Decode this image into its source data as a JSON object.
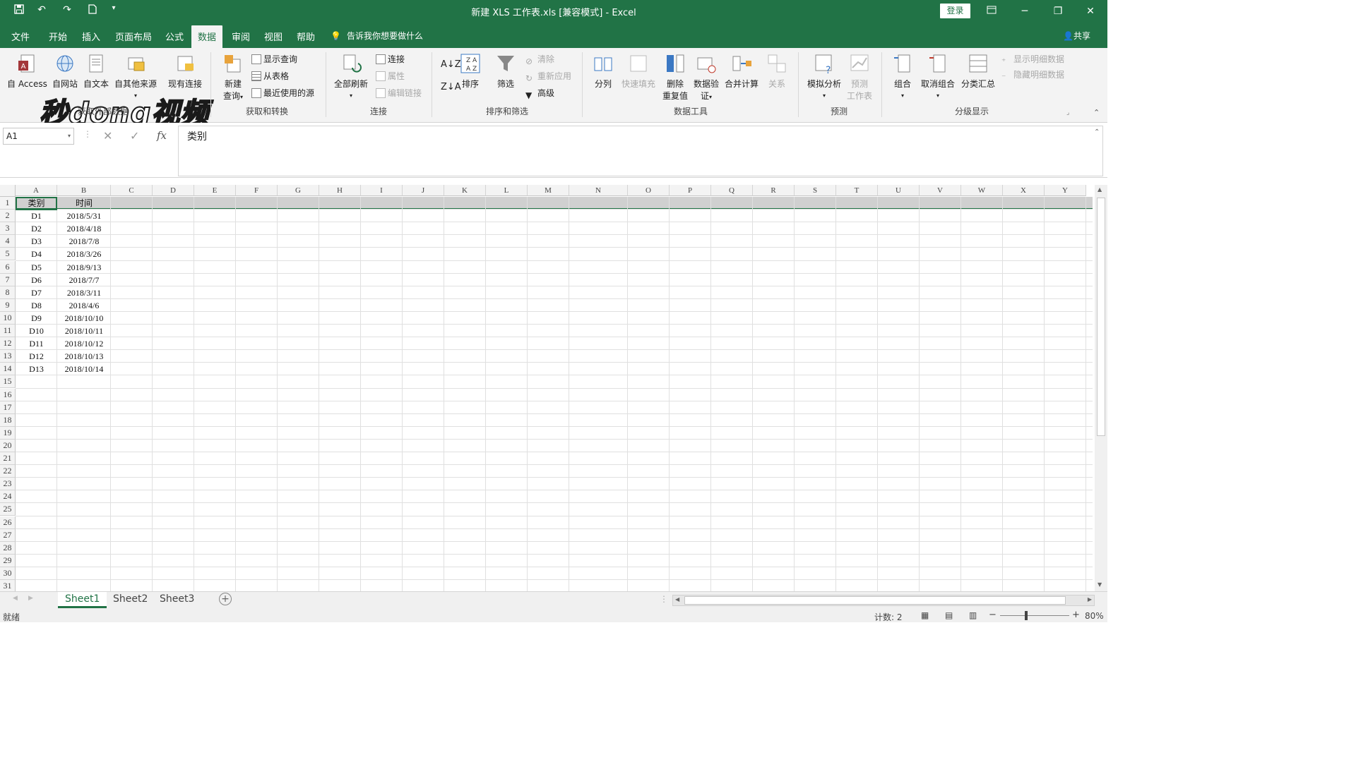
{
  "titlebar": {
    "title": "新建 XLS 工作表.xls  [兼容模式]  -  Excel",
    "login_label": "登录",
    "quick_access": [
      "save-icon",
      "undo-icon",
      "redo-icon",
      "new-file-icon",
      "customize-icon"
    ]
  },
  "ribbon_tabs": [
    "文件",
    "开始",
    "插入",
    "页面布局",
    "公式",
    "数据",
    "审阅",
    "视图",
    "帮助"
  ],
  "active_tab": "数据",
  "tell_me": "告诉我你想要做什么",
  "share_label": "共享",
  "watermark": "秒dong视频",
  "groups": {
    "external": {
      "label": "获取外部数据",
      "buttons": [
        "自 Access",
        "自网站",
        "自文本",
        "自其他来源",
        "现有连接"
      ]
    },
    "transform": {
      "label": "获取和转换",
      "new_query": "新建\n查询",
      "new_query_1": "新建",
      "new_query_2": "查询",
      "show_query": "显示查询",
      "from_table": "从表格",
      "recent_sources": "最近使用的源"
    },
    "connections": {
      "label": "连接",
      "refresh_all": "全部刷新",
      "connections": "连接",
      "properties": "属性",
      "edit_links": "编辑链接"
    },
    "sort_filter": {
      "label": "排序和筛选",
      "sort": "排序",
      "filter": "筛选",
      "clear": "清除",
      "reapply": "重新应用",
      "advanced": "高级"
    },
    "data_tools": {
      "label": "数据工具",
      "text_to_columns": "分列",
      "flash_fill": "快速填充",
      "remove_dup_1": "删除",
      "remove_dup_2": "重复值",
      "validation_1": "数据验",
      "validation_2": "证",
      "consolidate": "合并计算",
      "relationships": "关系"
    },
    "forecast": {
      "label": "预测",
      "what_if": "模拟分析",
      "forecast_1": "预测",
      "forecast_2": "工作表"
    },
    "outline": {
      "label": "分级显示",
      "group": "组合",
      "ungroup": "取消组合",
      "subtotal": "分类汇总",
      "show_detail": "显示明细数据",
      "hide_detail": "隐藏明细数据"
    }
  },
  "formula_bar": {
    "name_box": "A1",
    "fx": "fx",
    "content": "类别"
  },
  "columns": [
    "A",
    "B",
    "C",
    "D",
    "E",
    "F",
    "G",
    "H",
    "I",
    "J",
    "K",
    "L",
    "M",
    "N",
    "O",
    "P",
    "Q",
    "R",
    "S",
    "T",
    "U",
    "V",
    "W",
    "X",
    "Y"
  ],
  "rows": [
    "1",
    "2",
    "3",
    "4",
    "5",
    "6",
    "7",
    "8",
    "9",
    "10",
    "11",
    "12",
    "13",
    "14",
    "15",
    "16",
    "17",
    "18",
    "19",
    "20",
    "21",
    "22",
    "23",
    "24",
    "25",
    "26",
    "27",
    "28",
    "29",
    "30",
    "31"
  ],
  "table": {
    "headers": [
      "类别",
      "时间"
    ],
    "data": [
      [
        "D1",
        "2018/5/31"
      ],
      [
        "D2",
        "2018/4/18"
      ],
      [
        "D3",
        "2018/7/8"
      ],
      [
        "D4",
        "2018/3/26"
      ],
      [
        "D5",
        "2018/9/13"
      ],
      [
        "D6",
        "2018/7/7"
      ],
      [
        "D7",
        "2018/3/11"
      ],
      [
        "D8",
        "2018/4/6"
      ],
      [
        "D9",
        "2018/10/10"
      ],
      [
        "D10",
        "2018/10/11"
      ],
      [
        "D11",
        "2018/10/12"
      ],
      [
        "D12",
        "2018/10/13"
      ],
      [
        "D13",
        "2018/10/14"
      ]
    ]
  },
  "sheets": [
    "Sheet1",
    "Sheet2",
    "Sheet3"
  ],
  "active_sheet": "Sheet1",
  "status": {
    "ready": "就绪",
    "count": "计数: 2",
    "zoom": "80%"
  },
  "colors": {
    "accent": "#217346",
    "ribbon_bg": "#f3f3f3"
  }
}
